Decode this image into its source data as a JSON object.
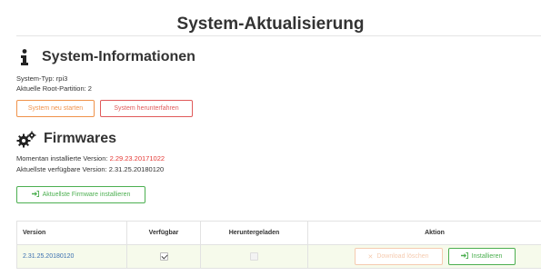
{
  "page": {
    "title": "System-Aktualisierung"
  },
  "system": {
    "title": "System-Informationen",
    "type_label": "System-Typ:",
    "type_value": "rpi3",
    "partition_label": "Aktuelle Root-Partition:",
    "partition_value": "2",
    "restart_label": "System neu starten",
    "shutdown_label": "System herunterfahren"
  },
  "firmware": {
    "title": "Firmwares",
    "installed_label": "Momentan installierte Version:",
    "installed_value": "2.29.23.20171022",
    "latest_label": "Aktuellste verfügbare Version:",
    "latest_value": "2.31.25.20180120",
    "install_latest_label": "Aktuellste Firmware installieren"
  },
  "table": {
    "columns": [
      "Version",
      "Verfügbar",
      "Heruntergeladen",
      "Aktion"
    ],
    "rows": [
      {
        "version": "2.31.25.20180120",
        "available": true,
        "downloaded": false,
        "delete_label": "Download löschen",
        "install_label": "Installieren"
      }
    ]
  },
  "colors": {
    "accent_red": "#e53935",
    "accent_green": "#4caf50",
    "accent_orange": "#f0924a",
    "row_highlight": "#f6faeb"
  },
  "icons": [
    "info-icon",
    "gears-icon",
    "download-icon",
    "times-icon",
    "sign-in-icon",
    "checkbox-icon"
  ]
}
